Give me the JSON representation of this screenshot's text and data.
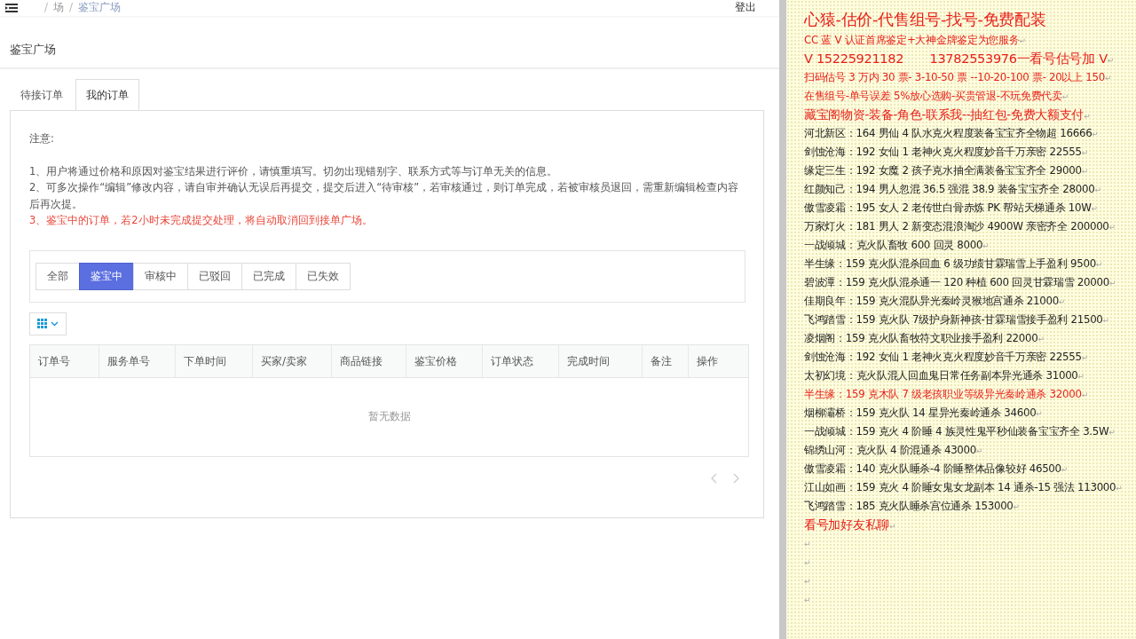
{
  "header": {
    "breadcrumb": [
      {
        "separator": "/",
        "label": "场"
      },
      {
        "separator": "/",
        "label": "鉴宝广场"
      }
    ],
    "logout": "登出"
  },
  "page_title": "鉴宝广场",
  "tabs": [
    {
      "label": "待接订单",
      "selected": false
    },
    {
      "label": "我的订单",
      "selected": true
    }
  ],
  "notice": {
    "heading": "注意:",
    "items": [
      {
        "kind": "normal",
        "text": "1、用户将通过价格和原因对鉴宝结果进行评价，请慎重填写。切勿出现错别字、联系方式等与订单无关的信息。"
      },
      {
        "kind": "normal",
        "text": "2、可多次操作“编辑”修改内容，请自审并确认无误后再提交，提交后进入“待审核”，若审核通过，则订单完成，若被审核员退回，需重新编辑检查内容后再次提。"
      },
      {
        "kind": "warning",
        "text": "3、鉴宝中的订单，若2小时未完成提交处理，将自动取消回到接单广场。"
      }
    ]
  },
  "filters": [
    {
      "label": "全部",
      "selected": false
    },
    {
      "label": "鉴宝中",
      "selected": true
    },
    {
      "label": "审核中",
      "selected": false
    },
    {
      "label": "已驳回",
      "selected": false
    },
    {
      "label": "已完成",
      "selected": false
    },
    {
      "label": "已失效",
      "selected": false
    }
  ],
  "table": {
    "columns": [
      "订单号",
      "服务单号",
      "下单时间",
      "买家/卖家",
      "商品链接",
      "鉴宝价格",
      "订单状态",
      "完成时间",
      "备注",
      "操作"
    ],
    "empty_text": "暂无数据"
  },
  "side_note": {
    "lines": [
      {
        "kind": "title",
        "color": "#e8201a",
        "text": "心猿-估价-代售组号-找号-免费配装"
      },
      {
        "kind": "normal",
        "color": "#e8201a",
        "text": "CC 蓝 V 认证首席鉴定+大神金牌鉴定为您服务",
        "mark": "↵"
      },
      {
        "kind": "large",
        "color": "#e8201a",
        "text": "V 15225921182　　13782553976一看号估号加 V",
        "mark": "↵"
      },
      {
        "kind": "normal",
        "color": "#e8201a",
        "text": "扫码估号 3 万内 30 票- 3-10-50 票 --10-20-100 票- 20以上 150",
        "mark": "↵"
      },
      {
        "kind": "normal",
        "color": "#e8201a",
        "text": "在售组号-单号误差 5%放心选购-买贵管退-不玩免费代卖",
        "mark": "↵"
      },
      {
        "kind": "medium",
        "color": "#e8201a",
        "text": "藏宝阁物资-装备-角色-联系我--抽红包-免费大额支付",
        "mark": "↵"
      },
      {
        "kind": "normal",
        "color": "#222222",
        "text": "河北新区：164 男仙 4 队水克火程度装备宝宝齐全物超 16666",
        "mark": "↵"
      },
      {
        "kind": "normal",
        "color": "#222222",
        "text": "剑蚀沧海：192 女仙 1 老神火克火程度妙音千万亲密 22555",
        "mark": "↵"
      },
      {
        "kind": "normal",
        "color": "#222222",
        "text": "缘定三生：192 女魔 2 孩子克水抽全满装备宝宝齐全 29000",
        "mark": "↵"
      },
      {
        "kind": "normal",
        "color": "#222222",
        "text": "红颜知己：194 男人忽混 36.5 强混 38.9 装备宝宝齐全 28000",
        "mark": "↵"
      },
      {
        "kind": "normal",
        "color": "#222222",
        "text": "傲雪凌霜：195 女人 2 老传世白骨赤炼 PK 帮站天梯通杀 10W",
        "mark": "↵"
      },
      {
        "kind": "normal",
        "color": "#222222",
        "text": "万家灯火：181 男人 2 新变态混浪淘沙 4900W 亲密齐全 200000",
        "mark": "↵"
      },
      {
        "kind": "normal",
        "color": "#222222",
        "text": "一战倾城：克火队畜牧 600 回灵 8000",
        "mark": "↵"
      },
      {
        "kind": "normal",
        "color": "#222222",
        "text": "半生缘：159 克火队混杀回血 6 级功绩甘霖瑞雪上手盈利 9500",
        "mark": "↵"
      },
      {
        "kind": "normal",
        "color": "#222222",
        "text": "碧波潭：159 克火队混杀通一 120 种植 600 回灵甘霖瑞雪 20000",
        "mark": "↵"
      },
      {
        "kind": "normal",
        "color": "#222222",
        "text": "佳期良年：159 克火混队异光秦岭灵猴地宫通杀 21000",
        "mark": "↵"
      },
      {
        "kind": "normal",
        "color": "#222222",
        "text": "飞鸿踏雪：159 克火队 7级护身新神孩-甘霖瑞雪接手盈利 21500",
        "mark": "↵"
      },
      {
        "kind": "normal",
        "color": "#222222",
        "text": "凌烟阁：159 克火队畜牧符文职业接手盈利 22000",
        "mark": "↵"
      },
      {
        "kind": "normal",
        "color": "#222222",
        "text": "剑蚀沧海：192 女仙 1 老神火克火程度妙音千万亲密 22555",
        "mark": "↵"
      },
      {
        "kind": "normal",
        "color": "#222222",
        "text": "太初幻境：克火队混人回血鬼日常任务副本异光通杀 31000",
        "mark": "↵"
      },
      {
        "kind": "normal",
        "color": "#e8201a",
        "text": "半生缘：159 克木队 7 级老孩职业等级异光秦岭通杀 32000",
        "mark": "↵"
      },
      {
        "kind": "normal",
        "color": "#222222",
        "text": "烟柳灞桥：159 克火队 14 星异光秦岭通杀 34600",
        "mark": "↵"
      },
      {
        "kind": "normal",
        "color": "#222222",
        "text": "一战倾城：159 克火 4 阶睡 4 族灵性鬼平秒仙装备宝宝齐全 3.5W",
        "mark": "↵"
      },
      {
        "kind": "normal",
        "color": "#222222",
        "text": "锦绣山河：克火队 4 阶混通杀 43000",
        "mark": "↵"
      },
      {
        "kind": "normal",
        "color": "#222222",
        "text": "傲雪凌霜：140 克火队睡杀-4 阶睡整体品像较好 46500",
        "mark": "↵"
      },
      {
        "kind": "normal",
        "color": "#222222",
        "text": "江山如画：159 克火 4 阶睡女鬼女龙副本 14 通杀-15 强法 113000",
        "mark": "↵"
      },
      {
        "kind": "normal",
        "color": "#222222",
        "text": "飞鸿踏雪：185 克火队睡杀宫位通杀 153000",
        "mark": "↵"
      },
      {
        "kind": "medium",
        "color": "#e8201a",
        "text": "看号加好友私聊",
        "mark": "↵"
      },
      {
        "kind": "normal",
        "mark": "↵"
      },
      {
        "kind": "normal",
        "mark": "↵"
      },
      {
        "kind": "normal",
        "mark": "↵"
      },
      {
        "kind": "normal",
        "mark": "↵"
      }
    ]
  }
}
